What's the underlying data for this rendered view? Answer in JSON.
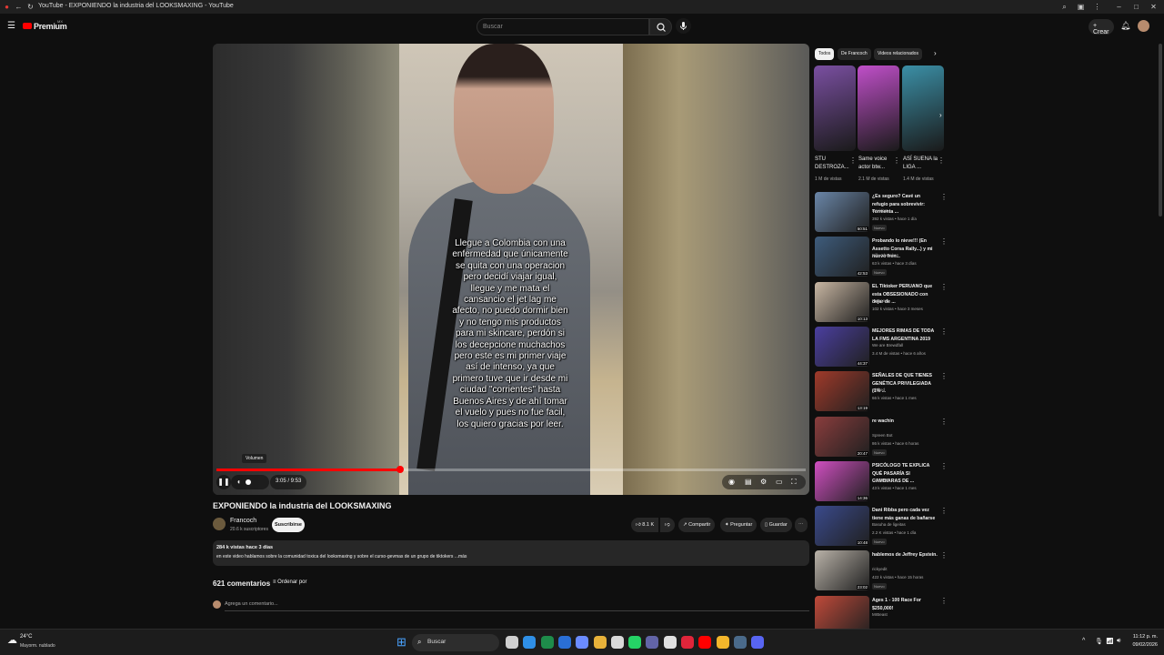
{
  "window": {
    "tab_title": "YouTube - EXPONIENDO la industria del LOOKSMAXING - YouTube"
  },
  "header": {
    "logo_text": "Premium",
    "logo_sup": "MX",
    "search_placeholder": "Buscar",
    "create_label": "Crear"
  },
  "player": {
    "caption": "Llegue a Colombia con una enfermedad que únicamente se quita con una operacion pero decidí viajar igual, llegue y me mata el cansancio el jet lag me afecto, no puedo dormir bien y no tengo mis productos para mi skincare, perdón si los decepcione muchachos pero este es mi primer viaje así de intenso, ya que primero tuve que ir desde mi ciudad \"corrientes\" hasta Buenos Aires y de ahí tomar el vuelo y pues no fue facil, los quiero gracias por leer.",
    "tooltip": "Volumen",
    "time": "3:05 / 9:53",
    "progress": 0.312
  },
  "video": {
    "title": "EXPONIENDO la industria del LOOKSMAXING",
    "channel": "Francoch",
    "subscribers": "20.6 k suscriptores",
    "subscribe_label": "Suscribirse",
    "likes": "8.1 K",
    "share_label": "Compartir",
    "ask_label": "Preguntar",
    "save_label": "Guardar",
    "stats": "284 k vistas  hace 3 días",
    "description": "en este video hablamos sobre la comunidad toxica del looksmaxing y sobre el curso-gevmas de un grupo de tiktokers ...más",
    "comments_count": "621 comentarios",
    "sort_label": "Ordenar por",
    "add_comment": "Agrega un comentario..."
  },
  "sidebar": {
    "chips": [
      "Todos",
      "De Francoch",
      "Videos relacionados"
    ],
    "shorts": [
      {
        "title": "STU DESTROZA...",
        "views": "1 M de vistas",
        "color": "#7a4fa1"
      },
      {
        "title": "Same voice actor btw...",
        "views": "2.1 M de vistas",
        "color": "#c04fc9"
      },
      {
        "title": "ASÍ SUENA la LIGA ...",
        "views": "1.4 M de vistas",
        "color": "#3b8fa6"
      }
    ],
    "videos": [
      {
        "title": "¿Es seguro? Cavé un refugio para sobrevivir: Tormenta ...",
        "channel": "Devidcat",
        "meta": "392 k vistas • hace 1 día",
        "duration": "50:51",
        "badge": "Nuevo",
        "color": "#6a86a8"
      },
      {
        "title": "Probando lo nieve!!! (En Assetto Corsa Rally...) y mi nuevo fren...",
        "channel": "Billy Cherokee",
        "meta": "63 k vistas • hace 3 días",
        "duration": "42:53",
        "badge": "Nuevo",
        "color": "#3e5c7c"
      },
      {
        "title": "EL Tiktoker PERUANO que esta OBSESIONADO con dejar de ...",
        "channel": "Francoch",
        "meta": "102 k vistas • hace 3 meses",
        "duration": "10:13",
        "badge": "",
        "color": "#c9b7a3"
      },
      {
        "title": "MEJORES RIMAS DE TODA LA FMS ARGENTINA 2019",
        "channel": "We are Brewdfall",
        "meta": "3.4 M de vistas • hace 6 años",
        "duration": "44:37",
        "badge": "",
        "color": "#4b3fa0"
      },
      {
        "title": "SEÑALES DE QUE TIENES GENÉTICA PRIVILEGIADA (1% ...",
        "channel": "Shifted",
        "meta": "66 k vistas • hace 1 mes",
        "duration": "13:19",
        "badge": "",
        "color": "#a03a2a"
      },
      {
        "title": "re wachin",
        "channel": "Spreen Bot",
        "meta": "86 k vistas • hace 6 horas",
        "duration": "20:47",
        "badge": "Nuevo",
        "color": "#8a3d3d"
      },
      {
        "title": "PSICÓLOGO TE EXPLICA QUÉ PASARÍA SI CAMBIARAS DE ...",
        "channel": "Cassy XD",
        "meta": "43 k vistas • hace 1 mes",
        "duration": "14:36",
        "badge": "",
        "color": "#d04fc1"
      },
      {
        "title": "Dani Ribba pero cada vez tiene más ganas de bañarse",
        "channel": "Basuha de ligeitas",
        "meta": "2.2 K vistas • hace 1 día",
        "duration": "10:48",
        "badge": "Nuevo",
        "color": "#3a4a8c"
      },
      {
        "title": "hablemos de Jeffrey Epstein.",
        "channel": "rickyedit",
        "meta": "422 k vistas • hace 15 horas",
        "duration": "23:02",
        "badge": "Nuevo",
        "color": "#b9b2a8"
      },
      {
        "title": "Ages 1 - 100 Race For $250,000!",
        "channel": "MrBeast",
        "meta": "",
        "duration": "",
        "badge": "",
        "color": "#c04a3a"
      }
    ]
  },
  "taskbar": {
    "weather_temp": "24°C",
    "weather_desc": "Mayorm. nublado",
    "search": "Buscar",
    "time": "11:12 p. m.",
    "date": "09/02/2026"
  }
}
